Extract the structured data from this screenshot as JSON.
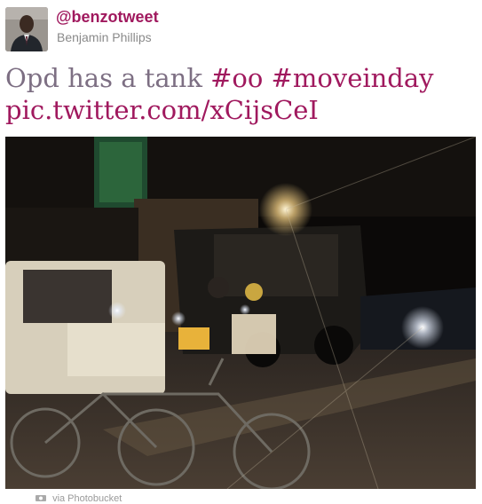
{
  "author": {
    "handle": "@benzotweet",
    "name": "Benjamin Phillips",
    "avatar_icon": "user-avatar-icon"
  },
  "tweet": {
    "text_plain": "Opd has a tank",
    "hashtags": [
      "#oo",
      "#moveinday"
    ],
    "link": "pic.twitter.com/xCijsCeI"
  },
  "photo": {
    "icon": "photo-image"
  },
  "footer": {
    "text": "via Photobucket",
    "icon": "camera-icon"
  },
  "colors": {
    "accent": "#a0195e",
    "text": "#7d6f83",
    "muted": "#8a8a8a"
  }
}
